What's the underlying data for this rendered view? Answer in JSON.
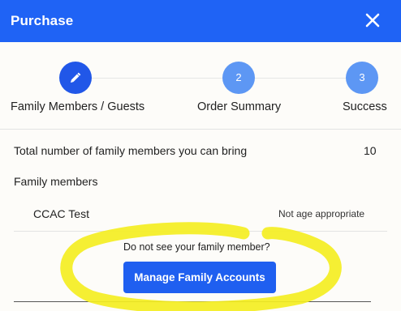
{
  "dialog": {
    "title": "Purchase",
    "close_icon": "close-icon"
  },
  "steps": [
    {
      "label": "Family Members / Guests",
      "marker": "pencil-icon",
      "state": "active"
    },
    {
      "label": "Order Summary",
      "marker": "2",
      "state": "pending"
    },
    {
      "label": "Success",
      "marker": "3",
      "state": "pending"
    }
  ],
  "summary": {
    "total_label": "Total number of family members you can bring",
    "total_value": "10"
  },
  "family": {
    "heading": "Family members",
    "members": [
      {
        "name": "CCAC Test",
        "status": "Not age appropriate"
      }
    ]
  },
  "footer": {
    "note": "Do not see your family member?",
    "manage_button": "Manage Family Accounts"
  },
  "colors": {
    "primary": "#1f63f5",
    "step_active": "#2157e8",
    "step_pending": "#5d97f4",
    "highlight": "#f4ee22"
  }
}
